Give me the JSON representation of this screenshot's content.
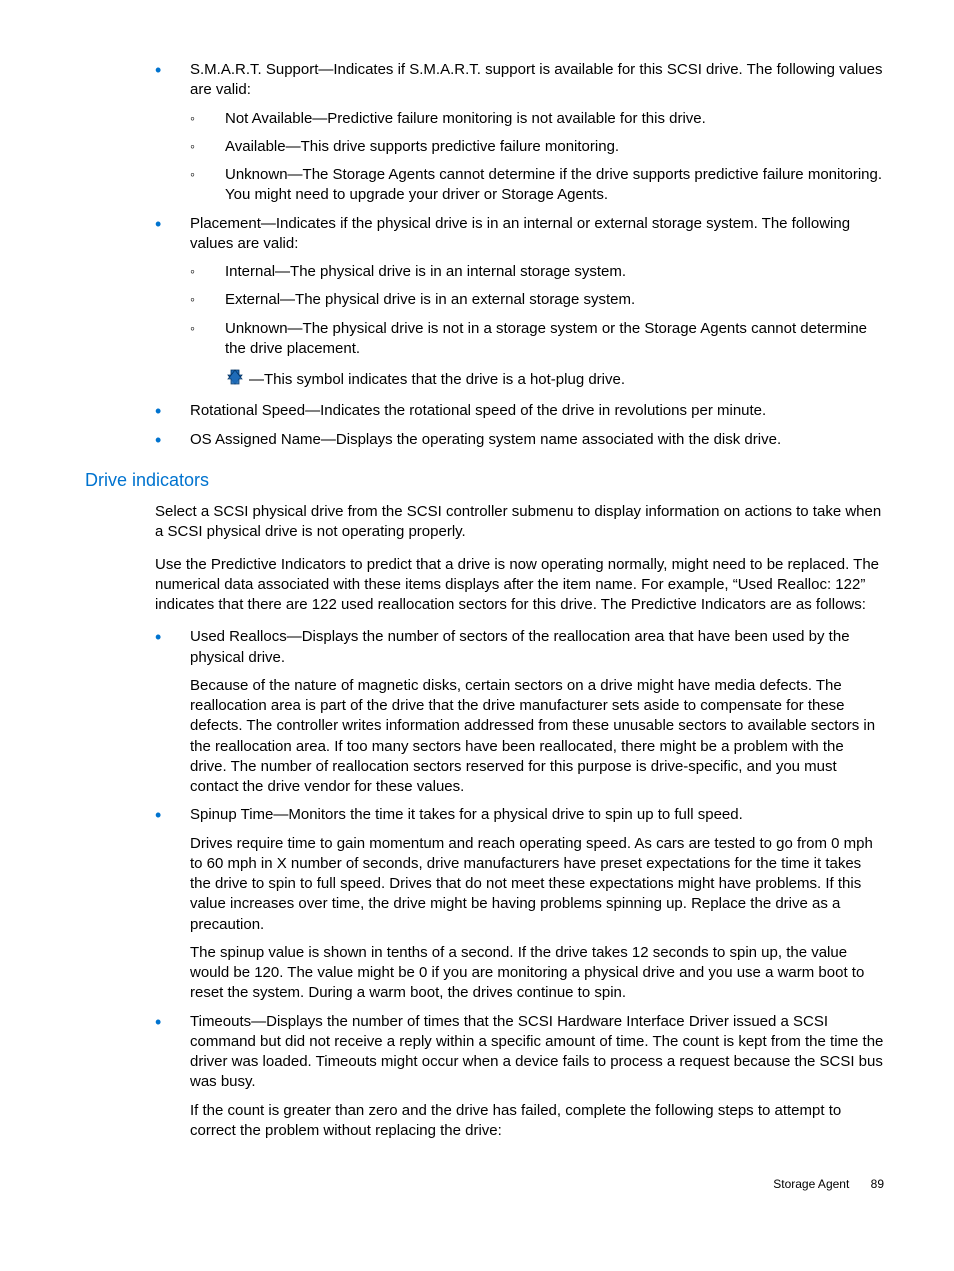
{
  "list1": {
    "smart": {
      "text": "S.M.A.R.T. Support—Indicates if S.M.A.R.T. support is available for this SCSI drive. The following values are valid:",
      "sub": {
        "na": "Not Available—Predictive failure monitoring is not available for this drive.",
        "avail": "Available—This drive supports predictive failure monitoring.",
        "unknown": "Unknown—The Storage Agents cannot determine if the drive supports predictive failure monitoring. You might need to upgrade your driver or Storage Agents."
      }
    },
    "placement": {
      "text": "Placement—Indicates if the physical drive is in an internal or external storage system. The following values are valid:",
      "sub": {
        "internal": "Internal—The physical drive is in an internal storage system.",
        "external": "External—The physical drive is in an external storage system.",
        "unknown": "Unknown—The physical drive is not in a storage system or the Storage Agents cannot determine the drive placement.",
        "hotplug": "—This symbol indicates that the drive is a hot-plug drive."
      }
    },
    "rotational": "Rotational Speed—Indicates the rotational speed of the drive in revolutions per minute.",
    "osname": "OS Assigned Name—Displays the operating system name associated with the disk drive."
  },
  "section_title": "Drive indicators",
  "intro1": "Select a SCSI physical drive from the SCSI controller submenu to display information on actions to take when a SCSI physical drive is not operating properly.",
  "intro2": "Use the Predictive Indicators to predict that a drive is now operating normally, might need to be replaced. The numerical data associated with these items displays after the item name. For example, “Used Realloc: 122” indicates that there are 122 used reallocation sectors for this drive. The Predictive Indicators are as follows:",
  "list2": {
    "used": {
      "text": "Used Reallocs—Displays the number of sectors of the reallocation area that have been used by the physical drive.",
      "para": "Because of the nature of magnetic disks, certain sectors on a drive might have media defects. The reallocation area is part of the drive that the drive manufacturer sets aside to compensate for these defects. The controller writes information addressed from these unusable sectors to available sectors in the reallocation area. If too many sectors have been reallocated, there might be a problem with the drive. The number of reallocation sectors reserved for this purpose is drive-specific, and you must contact the drive vendor for these values."
    },
    "spinup": {
      "text": "Spinup Time—Monitors the time it takes for a physical drive to spin up to full speed.",
      "para1": "Drives require time to gain momentum and reach operating speed. As cars are tested to go from 0 mph to 60 mph in X number of seconds, drive manufacturers have preset expectations for the time it takes the drive to spin to full speed. Drives that do not meet these expectations might have problems. If this value increases over time, the drive might be having problems spinning up. Replace the drive as a precaution.",
      "para2": "The spinup value is shown in tenths of a second. If the drive takes 12 seconds to spin up, the value would be 120. The value might be 0 if you are monitoring a physical drive and you use a warm boot to reset the system. During a warm boot, the drives continue to spin."
    },
    "timeouts": {
      "text": "Timeouts—Displays the number of times that the SCSI Hardware Interface Driver issued a SCSI command but did not receive a reply within a specific amount of time. The count is kept from the time the driver was loaded. Timeouts might occur when a device fails to process a request because the SCSI bus was busy.",
      "para": "If the count is greater than zero and the drive has failed, complete the following steps to attempt to correct the problem without replacing the drive:"
    }
  },
  "footer": {
    "label": "Storage Agent",
    "page": "89"
  }
}
